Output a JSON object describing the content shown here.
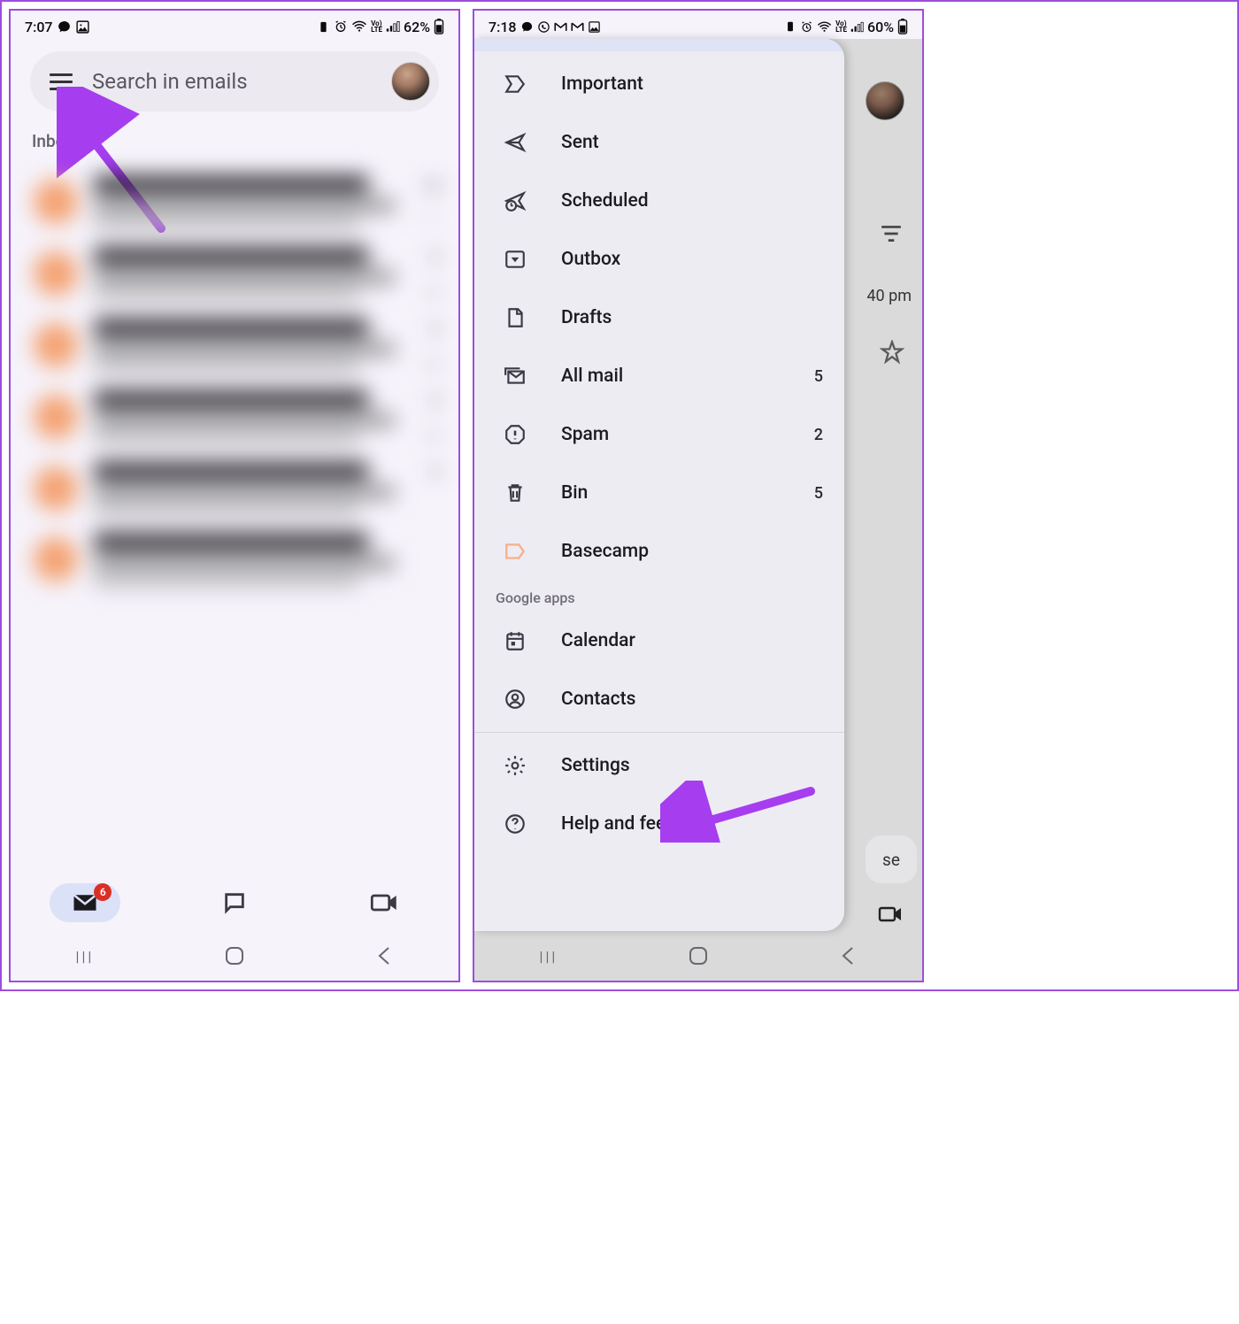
{
  "phone1": {
    "status": {
      "time": "7:07",
      "battery": "62%"
    },
    "search": {
      "placeholder": "Search in emails"
    },
    "section": "Inbox",
    "bottom": {
      "mail_badge": "6"
    }
  },
  "phone2": {
    "status": {
      "time": "7:18",
      "battery": "60%"
    },
    "bg": {
      "time": "40 pm",
      "sebtn": "se"
    },
    "drawer": {
      "items": [
        {
          "label": "Important",
          "icon": "important"
        },
        {
          "label": "Sent",
          "icon": "sent"
        },
        {
          "label": "Scheduled",
          "icon": "scheduled"
        },
        {
          "label": "Outbox",
          "icon": "outbox"
        },
        {
          "label": "Drafts",
          "icon": "drafts"
        },
        {
          "label": "All mail",
          "icon": "allmail",
          "count": "5"
        },
        {
          "label": "Spam",
          "icon": "spam",
          "count": "2"
        },
        {
          "label": "Bin",
          "icon": "bin",
          "count": "5"
        },
        {
          "label": "Basecamp",
          "icon": "label",
          "class": "basecamp-icon"
        }
      ],
      "section_google": "Google apps",
      "google_apps": [
        {
          "label": "Calendar",
          "icon": "calendar"
        },
        {
          "label": "Contacts",
          "icon": "contacts"
        }
      ],
      "footer": [
        {
          "label": "Settings",
          "icon": "settings"
        },
        {
          "label": "Help and feedback",
          "icon": "help"
        }
      ]
    }
  }
}
